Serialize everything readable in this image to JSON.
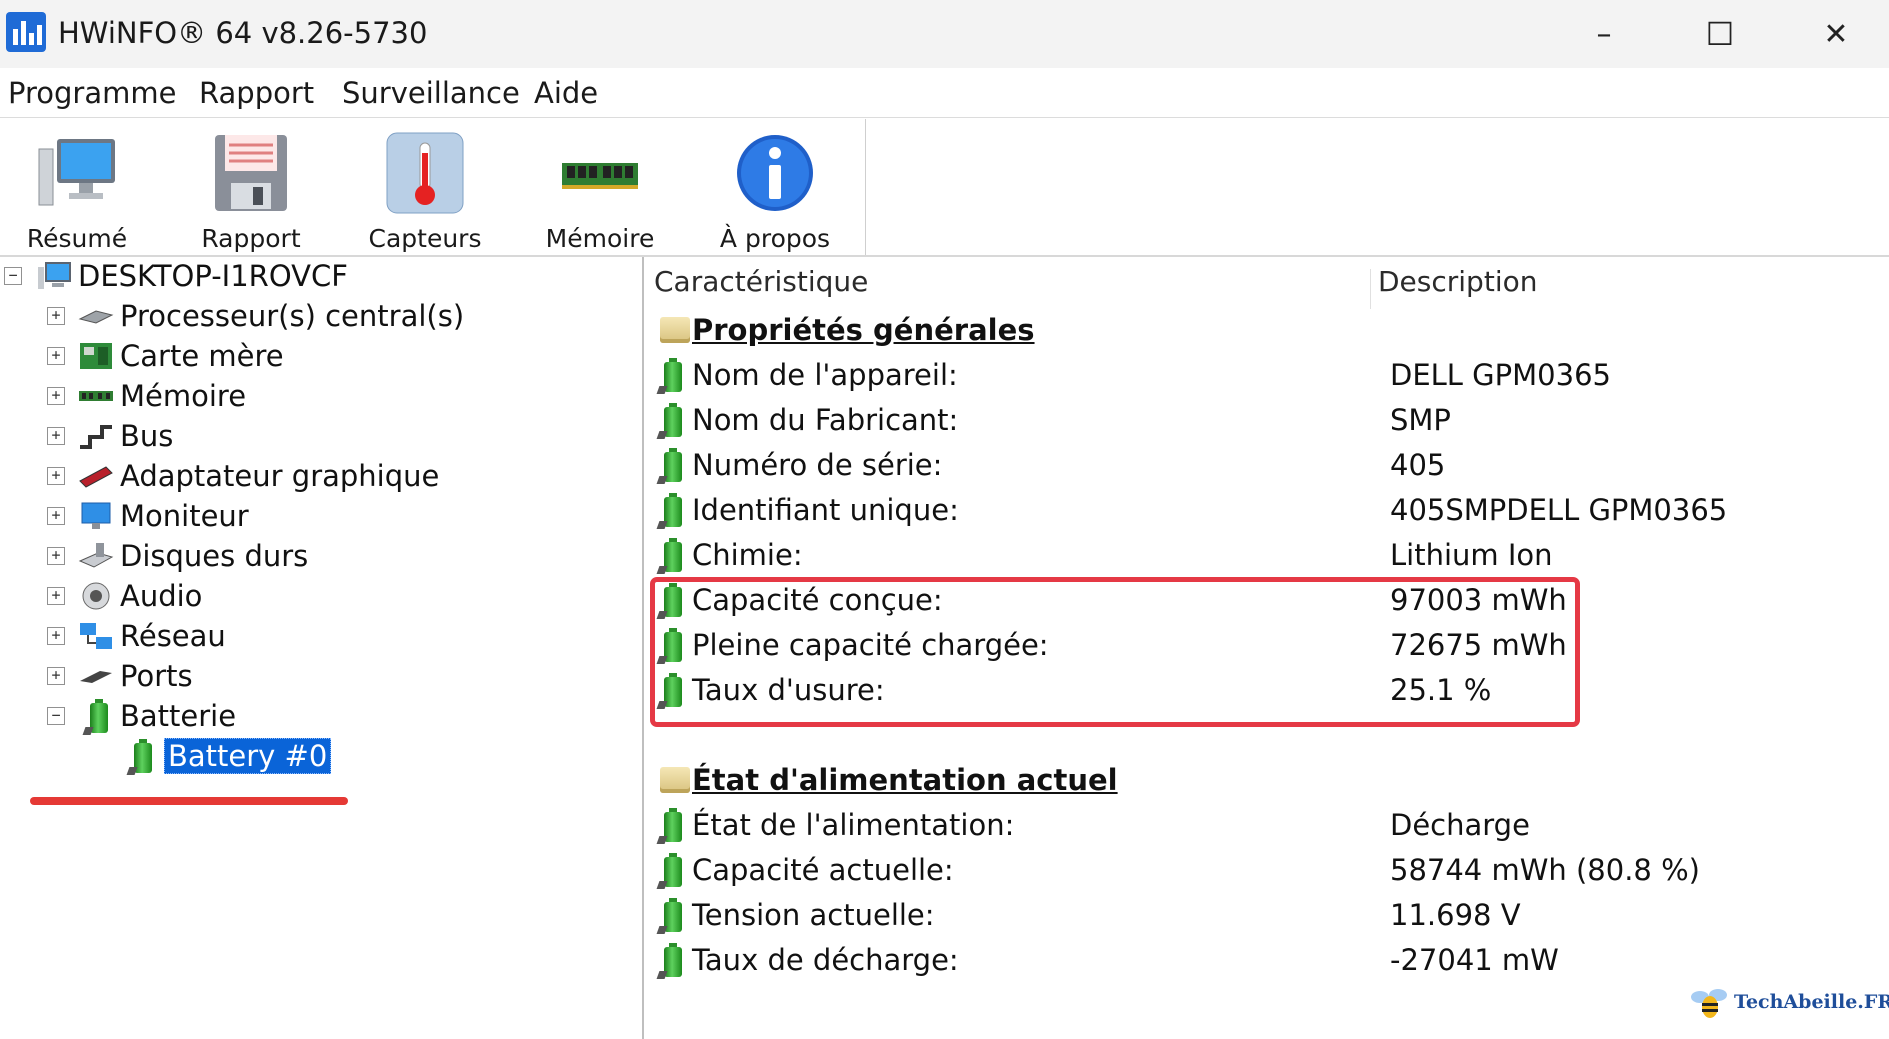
{
  "window": {
    "title": "HWiNFO® 64 v8.26-5730",
    "controls": [
      "–",
      "☐",
      "✕"
    ]
  },
  "menu": [
    "Programme",
    "Rapport",
    "Surveillance",
    "Aide"
  ],
  "toolbar": [
    {
      "label": "Résumé",
      "icon": "computer-icon"
    },
    {
      "label": "Rapport",
      "icon": "floppy-disk-icon"
    },
    {
      "label": "Capteurs",
      "icon": "thermometer-icon"
    },
    {
      "label": "Mémoire",
      "icon": "memory-module-icon"
    },
    {
      "label": "À propos",
      "icon": "info-icon"
    }
  ],
  "tree": {
    "root": "DESKTOP-I1ROVCF",
    "items": [
      {
        "label": "Processeur(s) central(s)",
        "icon": "cpu-icon",
        "expander": "+"
      },
      {
        "label": "Carte mère",
        "icon": "motherboard-icon",
        "expander": "+"
      },
      {
        "label": "Mémoire",
        "icon": "memory-icon",
        "expander": "+"
      },
      {
        "label": "Bus",
        "icon": "bus-icon",
        "expander": "+"
      },
      {
        "label": "Adaptateur graphique",
        "icon": "gpu-icon",
        "expander": "+"
      },
      {
        "label": "Moniteur",
        "icon": "monitor-icon",
        "expander": "+"
      },
      {
        "label": "Disques durs",
        "icon": "hard-drive-icon",
        "expander": "+"
      },
      {
        "label": "Audio",
        "icon": "speaker-icon",
        "expander": "+"
      },
      {
        "label": "Réseau",
        "icon": "network-icon",
        "expander": "+"
      },
      {
        "label": "Ports",
        "icon": "port-icon",
        "expander": "+"
      },
      {
        "label": "Batterie",
        "icon": "battery-icon",
        "expander": "−"
      }
    ],
    "selected": "Battery #0"
  },
  "details": {
    "headers": {
      "feature": "Caractéristique",
      "description": "Description"
    },
    "section1": {
      "title": "Propriétés générales",
      "rows": [
        {
          "k": "Nom de l'appareil:",
          "v": "DELL GPM0365"
        },
        {
          "k": "Nom du Fabricant:",
          "v": "SMP"
        },
        {
          "k": "Numéro de série:",
          "v": "405"
        },
        {
          "k": "Identifiant unique:",
          "v": "405SMPDELL GPM0365"
        },
        {
          "k": "Chimie:",
          "v": "Lithium Ion"
        },
        {
          "k": "Capacité conçue:",
          "v": "97003 mWh"
        },
        {
          "k": "Pleine capacité chargée:",
          "v": "72675 mWh"
        },
        {
          "k": "Taux d'usure:",
          "v": "25.1 %"
        }
      ]
    },
    "section2": {
      "title": "État d'alimentation actuel",
      "rows": [
        {
          "k": "État de l'alimentation:",
          "v": "Décharge"
        },
        {
          "k": "Capacité actuelle:",
          "v": "58744 mWh (80.8 %)"
        },
        {
          "k": "Tension actuelle:",
          "v": "11.698 V"
        },
        {
          "k": "Taux de décharge:",
          "v": "-27041 mW"
        }
      ]
    }
  },
  "watermark": "TechAbeille.FR",
  "colors": {
    "highlight": "#e53945",
    "selection": "#0a64d8",
    "accent": "#1f6bd6"
  }
}
